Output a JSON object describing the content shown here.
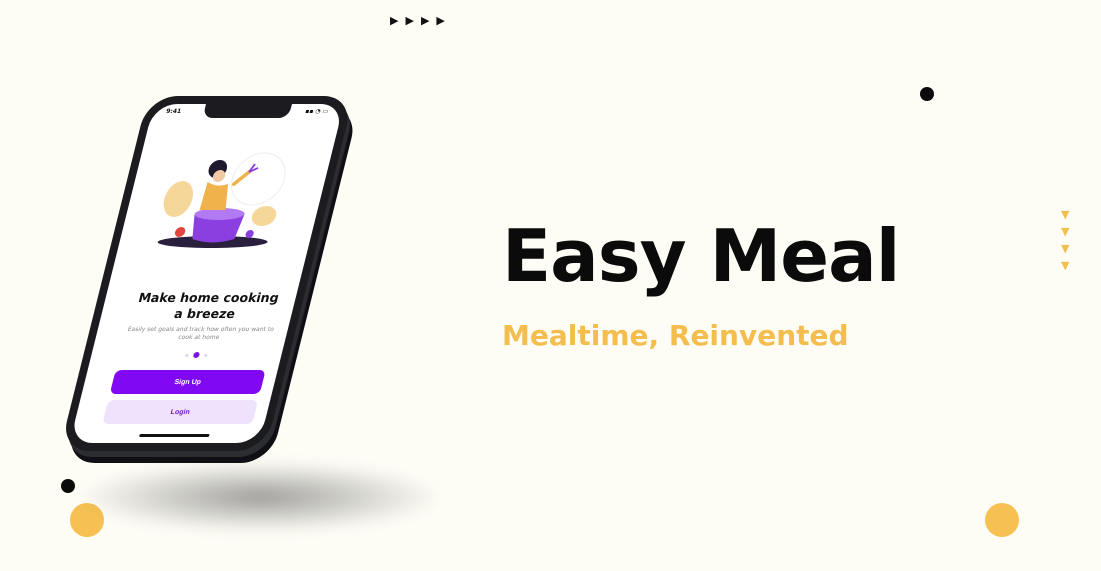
{
  "hero": {
    "title": "Easy Meal",
    "tagline": "Mealtime, Reinvented"
  },
  "phone_screen": {
    "status_time": "9:41",
    "title": "Make home cooking a breeze",
    "subtitle": "Easily set goals and track how often you want to cook at home",
    "pager": {
      "pages": 3,
      "active_index": 1
    },
    "signup_label": "Sign Up",
    "login_label": "Login"
  },
  "decor": {
    "arrow_glyph": "▶",
    "down_arrow_glyph": "▼"
  },
  "colors": {
    "background": "#fdfcf5",
    "accent_yellow": "#f6c152",
    "primary_purple": "#8108f2",
    "login_bg": "#efe2fd",
    "title_black": "#0b0b0b"
  }
}
